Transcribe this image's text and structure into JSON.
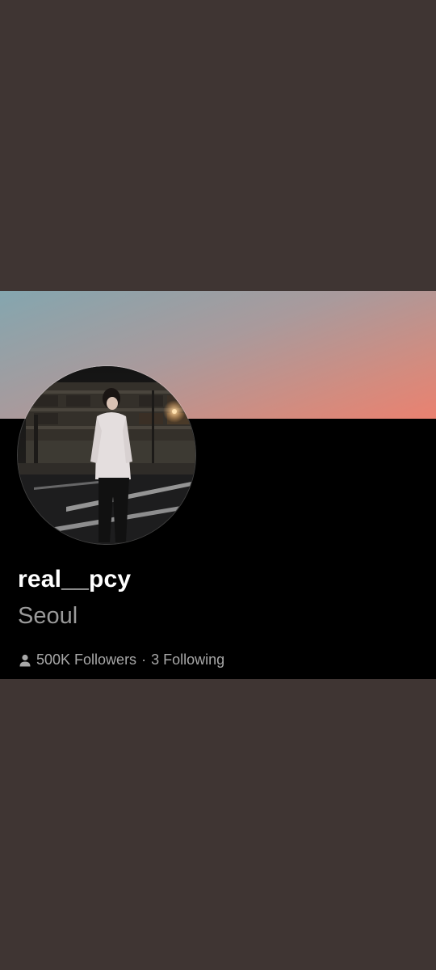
{
  "profile": {
    "username": "real__pcy",
    "location": "Seoul",
    "followers": "500K Followers",
    "separator": "·",
    "following": "3 Following"
  },
  "icons": {
    "followers": "person-icon"
  },
  "colors": {
    "page_background": "#3f3533",
    "card_background": "#000000",
    "cover_gradient_start": "#84a6af",
    "cover_gradient_end": "#ea8170",
    "username_color": "#ffffff",
    "secondary_text": "#9a9a9a"
  }
}
